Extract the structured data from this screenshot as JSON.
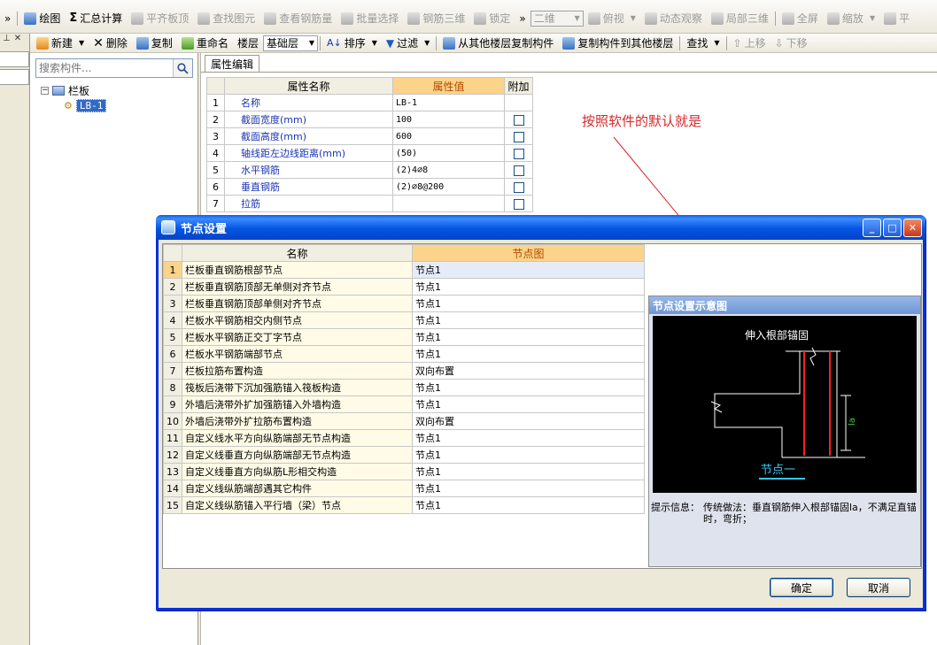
{
  "toolbar1": {
    "draw": "绘图",
    "summary_calc": "汇总计算",
    "flatten_board_top": "平齐板顶",
    "find_element": "查找图元",
    "view_rebar": "查看钢筋量",
    "batch_select": "批量选择",
    "rebar_3d": "钢筋三维",
    "lock": "锁定",
    "view_mode": "二维",
    "top_view": "俯视",
    "dynamic_observe": "动态观察",
    "local_3d": "局部三维",
    "fullscreen": "全屏",
    "zoom": "缩放",
    "tail": "平"
  },
  "toolbar2": {
    "new": "新建",
    "delete": "删除",
    "copy": "复制",
    "rename": "重命名",
    "floor_label": "楼层",
    "floor_value": "基础层",
    "sort": "排序",
    "filter": "过滤",
    "copy_from_floor": "从其他楼层复制构件",
    "copy_to_floor": "复制构件到其他楼层",
    "find": "查找",
    "move_up": "上移",
    "move_down": "下移"
  },
  "tree": {
    "search_placeholder": "搜索构件...",
    "root_label": "栏板",
    "child_label": "LB-1"
  },
  "property": {
    "tab_label": "属性编辑",
    "headers": [
      "属性名称",
      "属性值",
      "附加"
    ],
    "rows": [
      {
        "num": "1",
        "name": "名称",
        "value": "LB-1",
        "has_check": false
      },
      {
        "num": "2",
        "name": "截面宽度(mm)",
        "value": "100",
        "has_check": true
      },
      {
        "num": "3",
        "name": "截面高度(mm)",
        "value": "600",
        "has_check": true
      },
      {
        "num": "4",
        "name": "轴线距左边线距离(mm)",
        "value": "(50)",
        "has_check": true
      },
      {
        "num": "5",
        "name": "水平钢筋",
        "value": "(2)4⌀8",
        "has_check": true
      },
      {
        "num": "6",
        "name": "垂直钢筋",
        "value": "(2)⌀8@200",
        "has_check": true
      },
      {
        "num": "7",
        "name": "拉筋",
        "value": "",
        "has_check": true
      }
    ]
  },
  "annotation": "按照软件的默认就是",
  "dialog": {
    "title": "节点设置",
    "headers": [
      "名称",
      "节点图"
    ],
    "rows": [
      {
        "num": "1",
        "name": "栏板垂直钢筋根部节点",
        "value": "节点1"
      },
      {
        "num": "2",
        "name": "栏板垂直钢筋顶部无单侧对齐节点",
        "value": "节点1"
      },
      {
        "num": "3",
        "name": "栏板垂直钢筋顶部单侧对齐节点",
        "value": "节点1"
      },
      {
        "num": "4",
        "name": "栏板水平钢筋相交内侧节点",
        "value": "节点1"
      },
      {
        "num": "5",
        "name": "栏板水平钢筋正交丁字节点",
        "value": "节点1"
      },
      {
        "num": "6",
        "name": "栏板水平钢筋端部节点",
        "value": "节点1"
      },
      {
        "num": "7",
        "name": "栏板拉筋布置构造",
        "value": "双向布置"
      },
      {
        "num": "8",
        "name": "筏板后浇带下沉加强筋锚入筏板构造",
        "value": "节点1"
      },
      {
        "num": "9",
        "name": "外墙后浇带外扩加强筋锚入外墙构造",
        "value": "节点1"
      },
      {
        "num": "10",
        "name": "外墙后浇带外扩拉筋布置构造",
        "value": "双向布置"
      },
      {
        "num": "11",
        "name": "自定义线水平方向纵筋端部无节点构造",
        "value": "节点1"
      },
      {
        "num": "12",
        "name": "自定义线垂直方向纵筋端部无节点构造",
        "value": "节点1"
      },
      {
        "num": "13",
        "name": "自定义线垂直方向纵筋L形相交构造",
        "value": "节点1"
      },
      {
        "num": "14",
        "name": "自定义线纵筋端部遇其它构件",
        "value": "节点1"
      },
      {
        "num": "15",
        "name": "自定义线纵筋锚入平行墙（梁）节点",
        "value": "节点1"
      }
    ],
    "preview_title": "节点设置示意图",
    "preview_caption": "伸入根部锚固",
    "preview_node_label": "节点一",
    "preview_dim_label": "la",
    "hint_label": "提示信息：",
    "hint_text": "传统做法：垂直钢筋伸入根部锚固la，不满足直锚时，弯折；",
    "ok": "确定",
    "cancel": "取消"
  },
  "colors": {
    "title_bar": "#0555e3",
    "highlight_header": "#fbd38a",
    "annotation": "#d8282a",
    "selection": "#316ac5"
  }
}
